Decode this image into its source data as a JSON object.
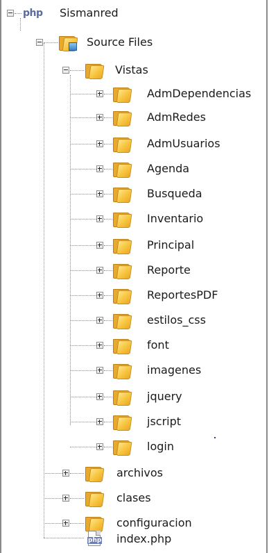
{
  "tree": {
    "project": "Sismanred",
    "project_icon_text": "php",
    "source_files": "Source Files",
    "vistas": "Vistas",
    "vistas_children": [
      "AdmDependencias",
      "AdmRedes",
      "AdmUsuarios",
      "Agenda",
      "Busqueda",
      "Inventario",
      "Principal",
      "Reporte",
      "ReportesPDF",
      "estilos_css",
      "font",
      "imagenes",
      "jquery",
      "jscript",
      "login"
    ],
    "source_children": [
      "archivos",
      "clases",
      "configuracion"
    ],
    "file": "index.php",
    "file_icon_text": "php"
  },
  "colors": {
    "folder": "#f7c43d",
    "folder_border": "#c68e1c",
    "guide_line": "#8c8c8c",
    "php_icon": "#5c6b9e"
  }
}
